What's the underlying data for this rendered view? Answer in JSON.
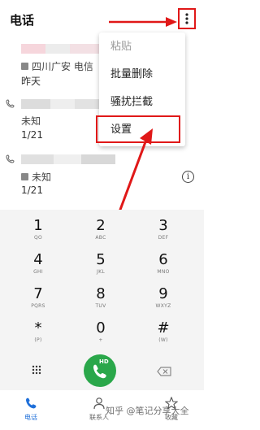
{
  "header": {
    "title": "电话"
  },
  "calls": [
    {
      "sim_label": "四川广安 电信",
      "date": "昨天"
    },
    {
      "sim_label": "未知",
      "date": "1/21"
    },
    {
      "sim_label": "未知",
      "date": "1/21"
    }
  ],
  "menu": {
    "items": [
      {
        "label": "粘贴",
        "enabled": false
      },
      {
        "label": "批量删除",
        "enabled": true
      },
      {
        "label": "骚扰拦截",
        "enabled": true
      },
      {
        "label": "设置",
        "enabled": true
      }
    ]
  },
  "keypad": {
    "keys": [
      {
        "digit": "1",
        "sub": "QO"
      },
      {
        "digit": "2",
        "sub": "ABC"
      },
      {
        "digit": "3",
        "sub": "DEF"
      },
      {
        "digit": "4",
        "sub": "GHI"
      },
      {
        "digit": "5",
        "sub": "JKL"
      },
      {
        "digit": "6",
        "sub": "MNO"
      },
      {
        "digit": "7",
        "sub": "PQRS"
      },
      {
        "digit": "8",
        "sub": "TUV"
      },
      {
        "digit": "9",
        "sub": "WXYZ"
      },
      {
        "digit": "*",
        "sub": "(P)"
      },
      {
        "digit": "0",
        "sub": "+"
      },
      {
        "digit": "#",
        "sub": "(W)"
      }
    ],
    "call_badge": "HD"
  },
  "nav": {
    "items": [
      {
        "label": "电话",
        "icon": "phone-icon",
        "active": true
      },
      {
        "label": "联系人",
        "icon": "contacts-icon",
        "active": false
      },
      {
        "label": "收藏",
        "icon": "star-icon",
        "active": false
      }
    ]
  },
  "watermark": "知乎 @笔记分享大全",
  "colors": {
    "accent": "#1e6fd9",
    "call_green": "#2aa74a",
    "annotation_red": "#e01818"
  }
}
